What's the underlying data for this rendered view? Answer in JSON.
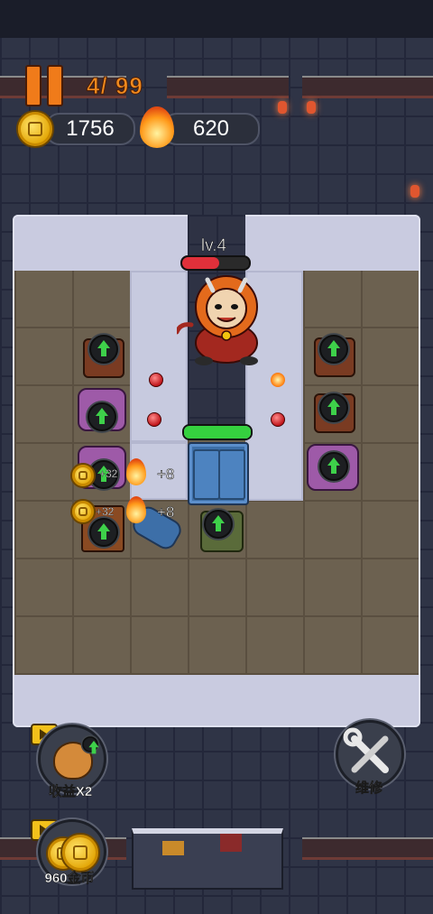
{
  "hud": {
    "wave_text": "4/ 99",
    "coins": "1756",
    "fire": "620",
    "icons": [
      "pause-icon",
      "coin-icon",
      "fire-icon"
    ]
  },
  "boss": {
    "level_label": "lv.4",
    "hp_fraction": 0.55
  },
  "door": {
    "hp_fraction": 1.0
  },
  "turrets": {
    "gains": [
      {
        "coin": "+32",
        "fire": "+8"
      },
      {
        "coin": "+32",
        "fire": "+8"
      }
    ]
  },
  "buttons": {
    "income": {
      "label": "收益X2"
    },
    "repair": {
      "label": "维修"
    },
    "coins_reward": {
      "label": "960金币"
    }
  },
  "colors": {
    "accent_orange": "#f07b1a",
    "hp_red": "#e0303a",
    "hp_green": "#35d13f",
    "upgrade_green": "#3ed04a"
  }
}
